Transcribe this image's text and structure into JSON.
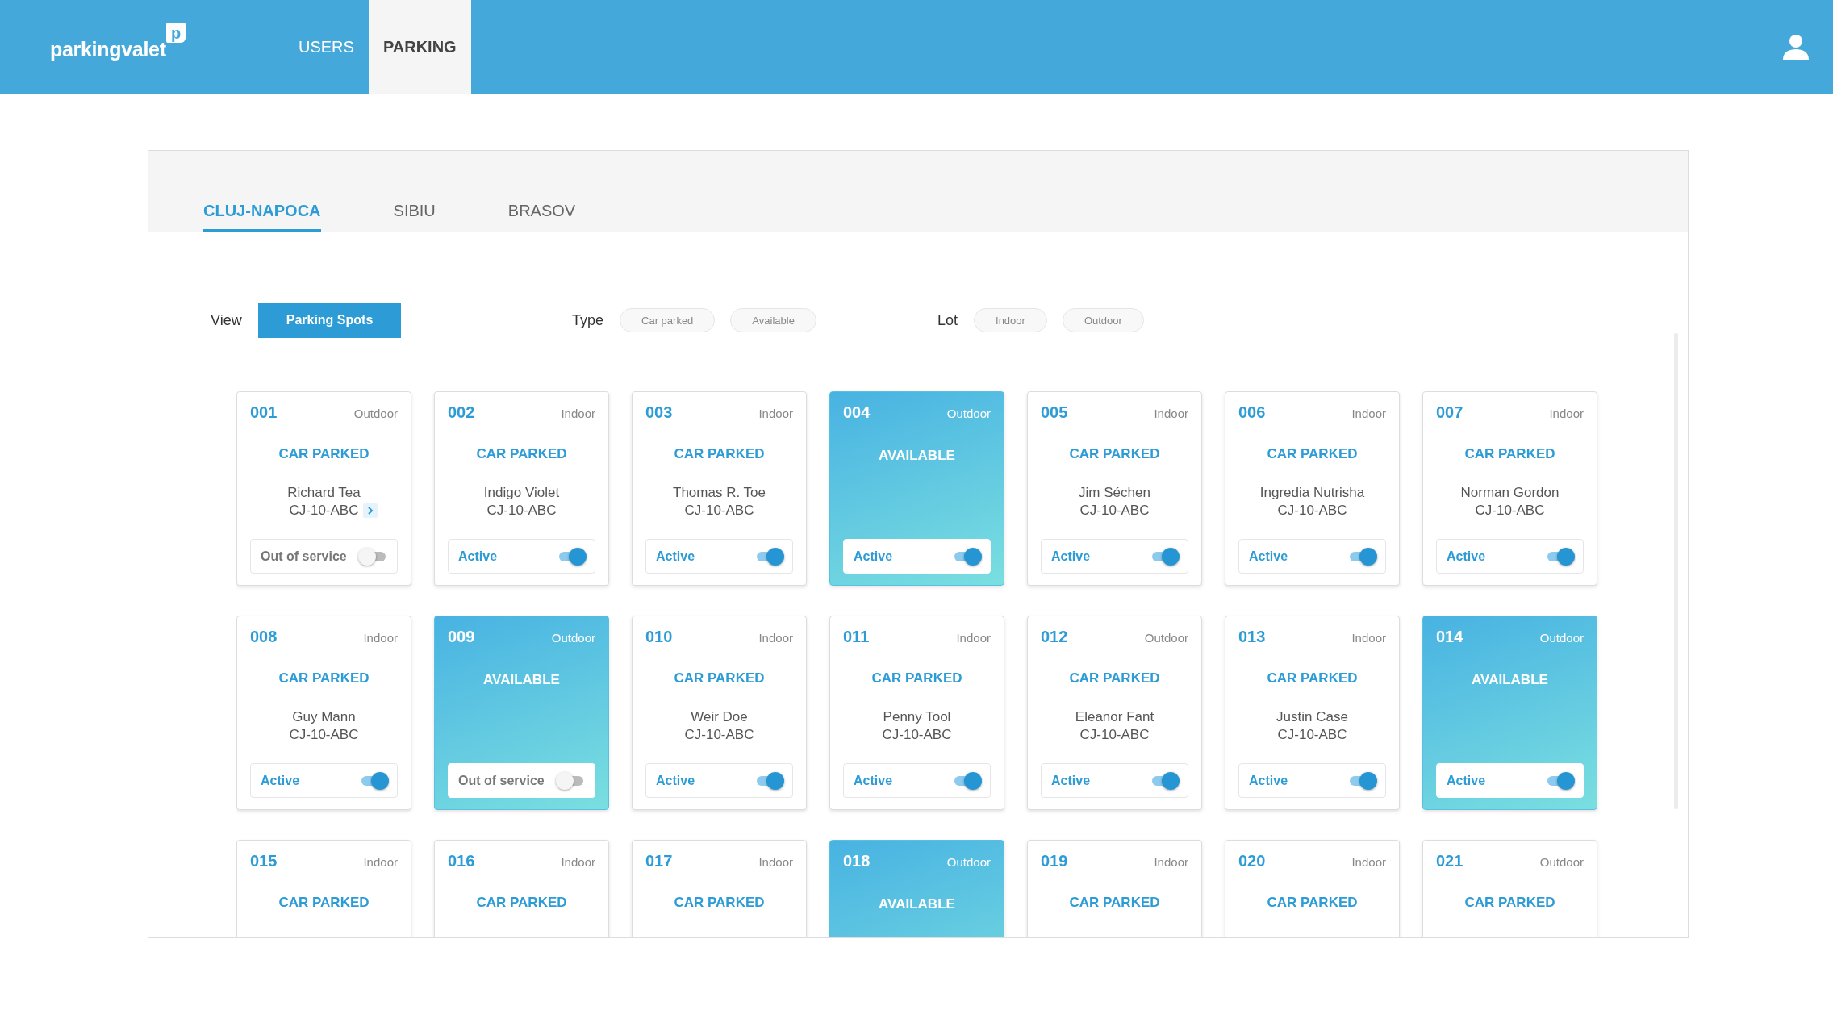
{
  "header": {
    "logo": {
      "text": "parkingvalet",
      "badge": "p"
    },
    "nav": [
      {
        "label": "USERS",
        "selected": false
      },
      {
        "label": "PARKING",
        "selected": true
      }
    ]
  },
  "city_tabs": [
    {
      "label": "CLUJ-NAPOCA",
      "selected": true
    },
    {
      "label": "SIBIU",
      "selected": false
    },
    {
      "label": "BRASOV",
      "selected": false
    }
  ],
  "filters": [
    {
      "label": "View",
      "kind": "buttons",
      "options": [
        {
          "label": "Parking Spots",
          "selected": true
        }
      ]
    },
    {
      "label": "Type",
      "kind": "chips",
      "options": [
        {
          "label": "Car parked",
          "selected": false
        },
        {
          "label": "Available",
          "selected": false
        }
      ]
    },
    {
      "label": "Lot",
      "kind": "chips",
      "options": [
        {
          "label": "Indoor",
          "selected": false
        },
        {
          "label": "Outdoor",
          "selected": false
        }
      ]
    }
  ],
  "spots": [
    {
      "number": "001",
      "lot": "Outdoor",
      "kind": "parked",
      "status": "CAR PARKED",
      "owner": "Richard Tea",
      "plate": "CJ-10-ABC",
      "details_link": true,
      "service": {
        "label": "Out of service",
        "on": false
      }
    },
    {
      "number": "002",
      "lot": "Indoor",
      "kind": "parked",
      "status": "CAR PARKED",
      "owner": "Indigo Violet",
      "plate": "CJ-10-ABC",
      "details_link": false,
      "service": {
        "label": "Active",
        "on": true
      }
    },
    {
      "number": "003",
      "lot": "Indoor",
      "kind": "parked",
      "status": "CAR PARKED",
      "owner": "Thomas R. Toe",
      "plate": "CJ-10-ABC",
      "details_link": false,
      "service": {
        "label": "Active",
        "on": true
      }
    },
    {
      "number": "004",
      "lot": "Outdoor",
      "kind": "available",
      "status": "AVAILABLE",
      "service": {
        "label": "Active",
        "on": true
      }
    },
    {
      "number": "005",
      "lot": "Indoor",
      "kind": "parked",
      "status": "CAR PARKED",
      "owner": "Jim Séchen",
      "plate": "CJ-10-ABC",
      "details_link": false,
      "service": {
        "label": "Active",
        "on": true
      }
    },
    {
      "number": "006",
      "lot": "Indoor",
      "kind": "parked",
      "status": "CAR PARKED",
      "owner": "Ingredia Nutrisha",
      "plate": "CJ-10-ABC",
      "details_link": false,
      "service": {
        "label": "Active",
        "on": true
      }
    },
    {
      "number": "007",
      "lot": "Indoor",
      "kind": "parked",
      "status": "CAR PARKED",
      "owner": "Norman Gordon",
      "plate": "CJ-10-ABC",
      "details_link": false,
      "service": {
        "label": "Active",
        "on": true
      }
    },
    {
      "number": "008",
      "lot": "Indoor",
      "kind": "parked",
      "status": "CAR PARKED",
      "owner": "Guy Mann",
      "plate": "CJ-10-ABC",
      "details_link": false,
      "service": {
        "label": "Active",
        "on": true
      }
    },
    {
      "number": "009",
      "lot": "Outdoor",
      "kind": "available",
      "status": "AVAILABLE",
      "service": {
        "label": "Out of service",
        "on": false
      }
    },
    {
      "number": "010",
      "lot": "Indoor",
      "kind": "parked",
      "status": "CAR PARKED",
      "owner": "Weir Doe",
      "plate": "CJ-10-ABC",
      "details_link": false,
      "service": {
        "label": "Active",
        "on": true
      }
    },
    {
      "number": "011",
      "lot": "Indoor",
      "kind": "parked",
      "status": "CAR PARKED",
      "owner": "Penny Tool",
      "plate": "CJ-10-ABC",
      "details_link": false,
      "service": {
        "label": "Active",
        "on": true
      }
    },
    {
      "number": "012",
      "lot": "Outdoor",
      "kind": "parked",
      "status": "CAR PARKED",
      "owner": "Eleanor Fant",
      "plate": "CJ-10-ABC",
      "details_link": false,
      "service": {
        "label": "Active",
        "on": true
      }
    },
    {
      "number": "013",
      "lot": "Indoor",
      "kind": "parked",
      "status": "CAR PARKED",
      "owner": "Justin Case",
      "plate": "CJ-10-ABC",
      "details_link": false,
      "service": {
        "label": "Active",
        "on": true
      }
    },
    {
      "number": "014",
      "lot": "Outdoor",
      "kind": "available",
      "status": "AVAILABLE",
      "service": {
        "label": "Active",
        "on": true
      }
    },
    {
      "number": "015",
      "lot": "Indoor",
      "kind": "parked",
      "status": "CAR PARKED"
    },
    {
      "number": "016",
      "lot": "Indoor",
      "kind": "parked",
      "status": "CAR PARKED"
    },
    {
      "number": "017",
      "lot": "Indoor",
      "kind": "parked",
      "status": "CAR PARKED"
    },
    {
      "number": "018",
      "lot": "Outdoor",
      "kind": "available",
      "status": "AVAILABLE"
    },
    {
      "number": "019",
      "lot": "Indoor",
      "kind": "parked",
      "status": "CAR PARKED"
    },
    {
      "number": "020",
      "lot": "Indoor",
      "kind": "parked",
      "status": "CAR PARKED"
    },
    {
      "number": "021",
      "lot": "Outdoor",
      "kind": "parked",
      "status": "CAR PARKED"
    }
  ]
}
